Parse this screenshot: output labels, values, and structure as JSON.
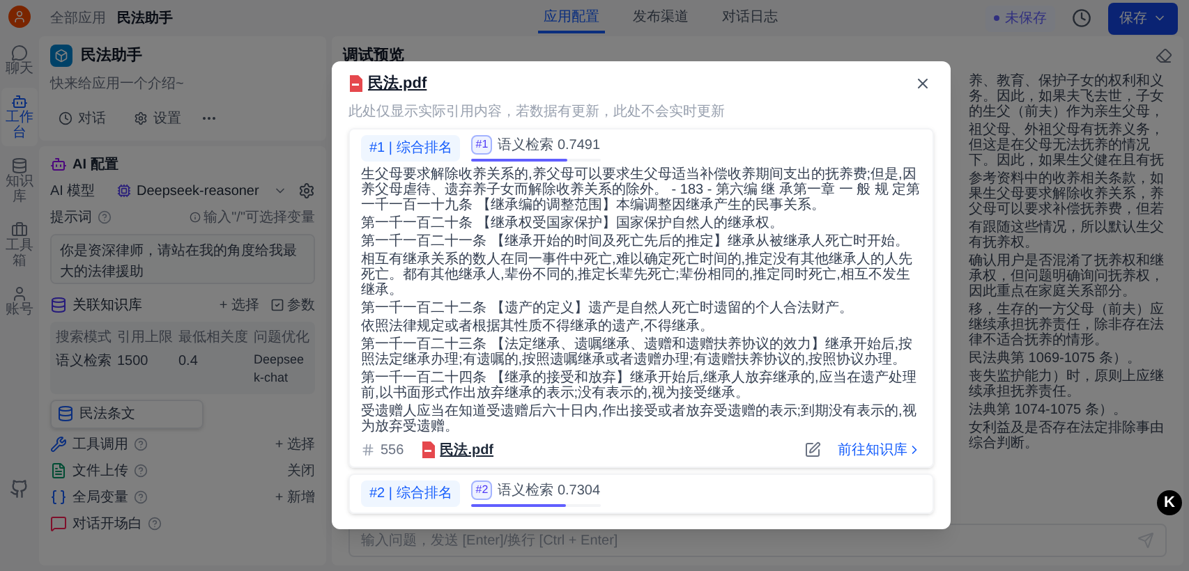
{
  "nav": {
    "items": [
      {
        "label": "聊天",
        "selected": false
      },
      {
        "label": "工作台",
        "selected": true
      },
      {
        "label": "知识库",
        "selected": false
      },
      {
        "label": "工具箱",
        "selected": false
      },
      {
        "label": "账号",
        "selected": false
      }
    ]
  },
  "breadcrumb": [
    "全部应用",
    "民法助手"
  ],
  "tabs": [
    {
      "label": "应用配置",
      "selected": true
    },
    {
      "label": "发布渠道",
      "selected": false
    },
    {
      "label": "对话日志",
      "selected": false
    }
  ],
  "save_status": "未保存",
  "save_button": "保存",
  "app": {
    "name": "民法助手",
    "intro": "快来给应用一个介绍~",
    "actions": [
      "对话",
      "设置"
    ]
  },
  "ai_config": {
    "title": "AI 配置",
    "model_label": "AI 模型",
    "model": "Deepseek-reasoner",
    "prompt_label": "提示词",
    "prompt_hint": "输入\"/\"可选择变量",
    "prompt": "你是资深律师，请站在我的角度给我最大的法律援助"
  },
  "knowledge": {
    "title": "关联知识库",
    "select": "+ 选择",
    "params": "参数",
    "columns": [
      "搜索模式",
      "引用上限",
      "最低相关度",
      "问题优化"
    ],
    "row": [
      "语义检索",
      "1500",
      "0.4",
      "Deepseek-chat"
    ],
    "datasets": [
      "民法条文"
    ]
  },
  "sections": [
    {
      "kind": "tools",
      "title": "工具调用",
      "action": "+ 选择"
    },
    {
      "kind": "file",
      "title": "文件上传",
      "action": "关闭"
    },
    {
      "kind": "variables",
      "title": "全局变量",
      "action": "+ 新增"
    },
    {
      "kind": "welcome",
      "title": "对话开场白"
    }
  ],
  "debug": {
    "title": "调试预览",
    "answer_fragments": [
      "养、教育、保护子女的权利和义务。因此，如果夫飞去世，子女的生父（前夫）作为亲生父母，",
      "祖父母、外祖父母有抚养义务，但这是在父母无法抚养的情况下。因此，如果生父健在且有抚",
      "参考资料中的收养相关条款，如果生父母要求解除收养关系，养父母可以要求补偿抚养费，但若",
      "有跟随这些情况，所以默认生父有抚养权。",
      "确认用户是否混淆了抚养权和继承权，但问题明确询问抚养权，因此重点在家庭关系部分。",
      "移，生存的一方父母（前夫）应继续承担抚养责任，除非存在法律不适合抚养的情形。",
      "民法典第 1069-1075 条）。",
      "丧失监护能力）时，原则上应继续承担抚养责任。",
      "法典第 1074-1075 条）。",
      "女利益及是否存在法定排除事由综合判断。"
    ],
    "input_placeholder": "输入问题，发送 [Enter]/换行 [Ctrl + Enter]"
  },
  "floating_badge": "K",
  "modal": {
    "title": "民法.pdf",
    "note": "此处仅显示实际引用内容，若数据有更新，此处不会实时更新",
    "results": [
      {
        "rank_tab": "#1 | 综合排名",
        "score_index": "#1",
        "score_text": "语义检索 0.7491",
        "level": 0.75,
        "paragraphs": [
          "生父母要求解除收养关系的,养父母可以要求生父母适当补偿收养期间支出的抚养费;但是,因养父母虐待、遗弃养子女而解除收养关系的除外。 - 183 - 第六编 继 承第一章 一 般 规 定第一千一百一十九条 【继承编的调整范围】本编调整因继承产生的民事关系。",
          "第一千一百二十条 【继承权受国家保护】国家保护自然人的继承权。",
          "第一千一百二十一条 【继承开始的时间及死亡先后的推定】继承从被继承人死亡时开始。",
          "相互有继承关系的数人在同一事件中死亡,难以确定死亡时间的,推定没有其他继承人的人先死亡。都有其他继承人,辈份不同的,推定长辈先死亡;辈份相同的,推定同时死亡,相互不发生继承。",
          "第一千一百二十二条 【遗产的定义】遗产是自然人死亡时遗留的个人合法财产。",
          "依照法律规定或者根据其性质不得继承的遗产,不得继承。",
          "第一千一百二十三条 【法定继承、遗嘱继承、遗赠和遗赠扶养协议的效力】继承开始后,按照法定继承办理;有遗嘱的,按照遗嘱继承或者遗赠办理;有遗赠扶养协议的,按照协议办理。",
          "第一千一百二十四条 【继承的接受和放弃】继承开始后,继承人放弃继承的,应当在遗产处理前,以书面形式作出放弃继承的表示;没有表示的,视为接受继承。",
          "受遗赠人应当在知道受遗赠后六十日内,作出接受或者放弃受遗赠的表示;到期没有表示的,视为放弃受遗赠。"
        ],
        "index": "556",
        "source": "民法.pdf",
        "link": "前往知识库"
      },
      {
        "rank_tab": "#2 | 综合排名",
        "score_index": "#2",
        "score_text": "语义检索 0.7304",
        "level": 0.73
      }
    ]
  }
}
